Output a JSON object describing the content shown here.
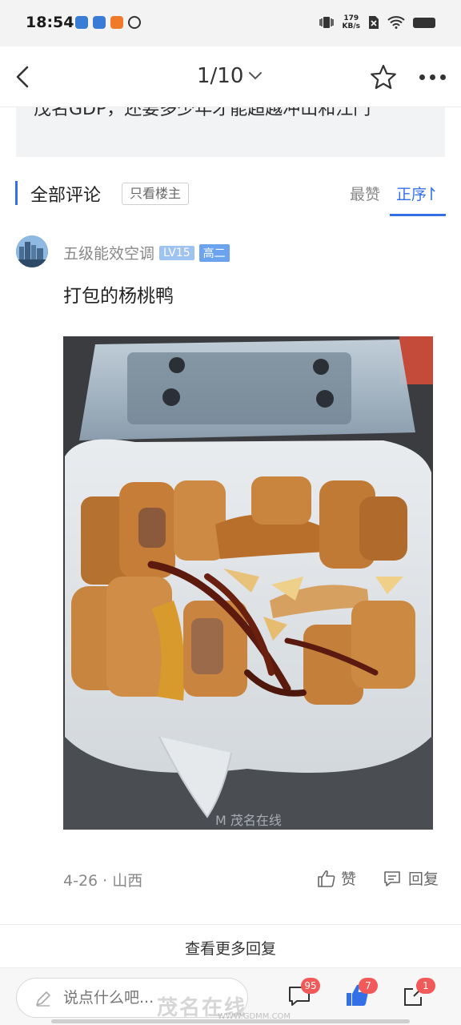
{
  "status_bar": {
    "time": "18:54",
    "net_speed_value": "179",
    "net_speed_unit": "KB/s"
  },
  "header": {
    "page_indicator": "1/10"
  },
  "quote": {
    "text": "茂名GDP，还要多少年才能超越冲山和江门"
  },
  "comments_section": {
    "title": "全部评论",
    "op_only": "只看楼主",
    "sort_hot": "最赞",
    "sort_seq": "正序"
  },
  "comment": {
    "username": "五级能效空调",
    "level": "LV15",
    "grade": "高二",
    "text": "打包的杨桃鸭",
    "meta": "4-26 · 山西",
    "like_label": "赞",
    "reply_label": "回复"
  },
  "more_replies": "查看更多回复",
  "bottom_bar": {
    "input_placeholder": "说点什么吧...",
    "comment_count": "95",
    "like_count": "7",
    "share_count": "1"
  },
  "watermark": {
    "text": "茂名在线",
    "url": "WWW.GDMM.COM"
  },
  "colors": {
    "accent": "#3370e8",
    "badge_red": "#f25a5a"
  }
}
